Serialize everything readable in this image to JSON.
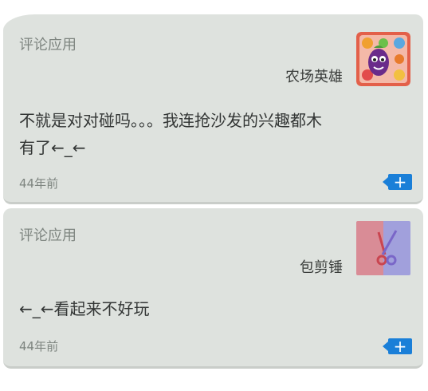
{
  "comments": [
    {
      "label": "评论应用",
      "app_name": "农场英雄",
      "app_icon": "farm-heroes-app-icon",
      "text": "不就是对对碰吗。。。我连抢沙发的兴趣都木\n有了←_←",
      "time": "44年前",
      "action_label": "+"
    },
    {
      "label": "评论应用",
      "app_name": "包剪锤",
      "app_icon": "rock-paper-scissors-app-icon",
      "text": "←_←看起来不好玩",
      "time": "44年前",
      "action_label": "+"
    }
  ],
  "colors": {
    "card_bg": "#dee2de",
    "accent": "#1a7fd8",
    "muted_text": "#7e8580"
  }
}
